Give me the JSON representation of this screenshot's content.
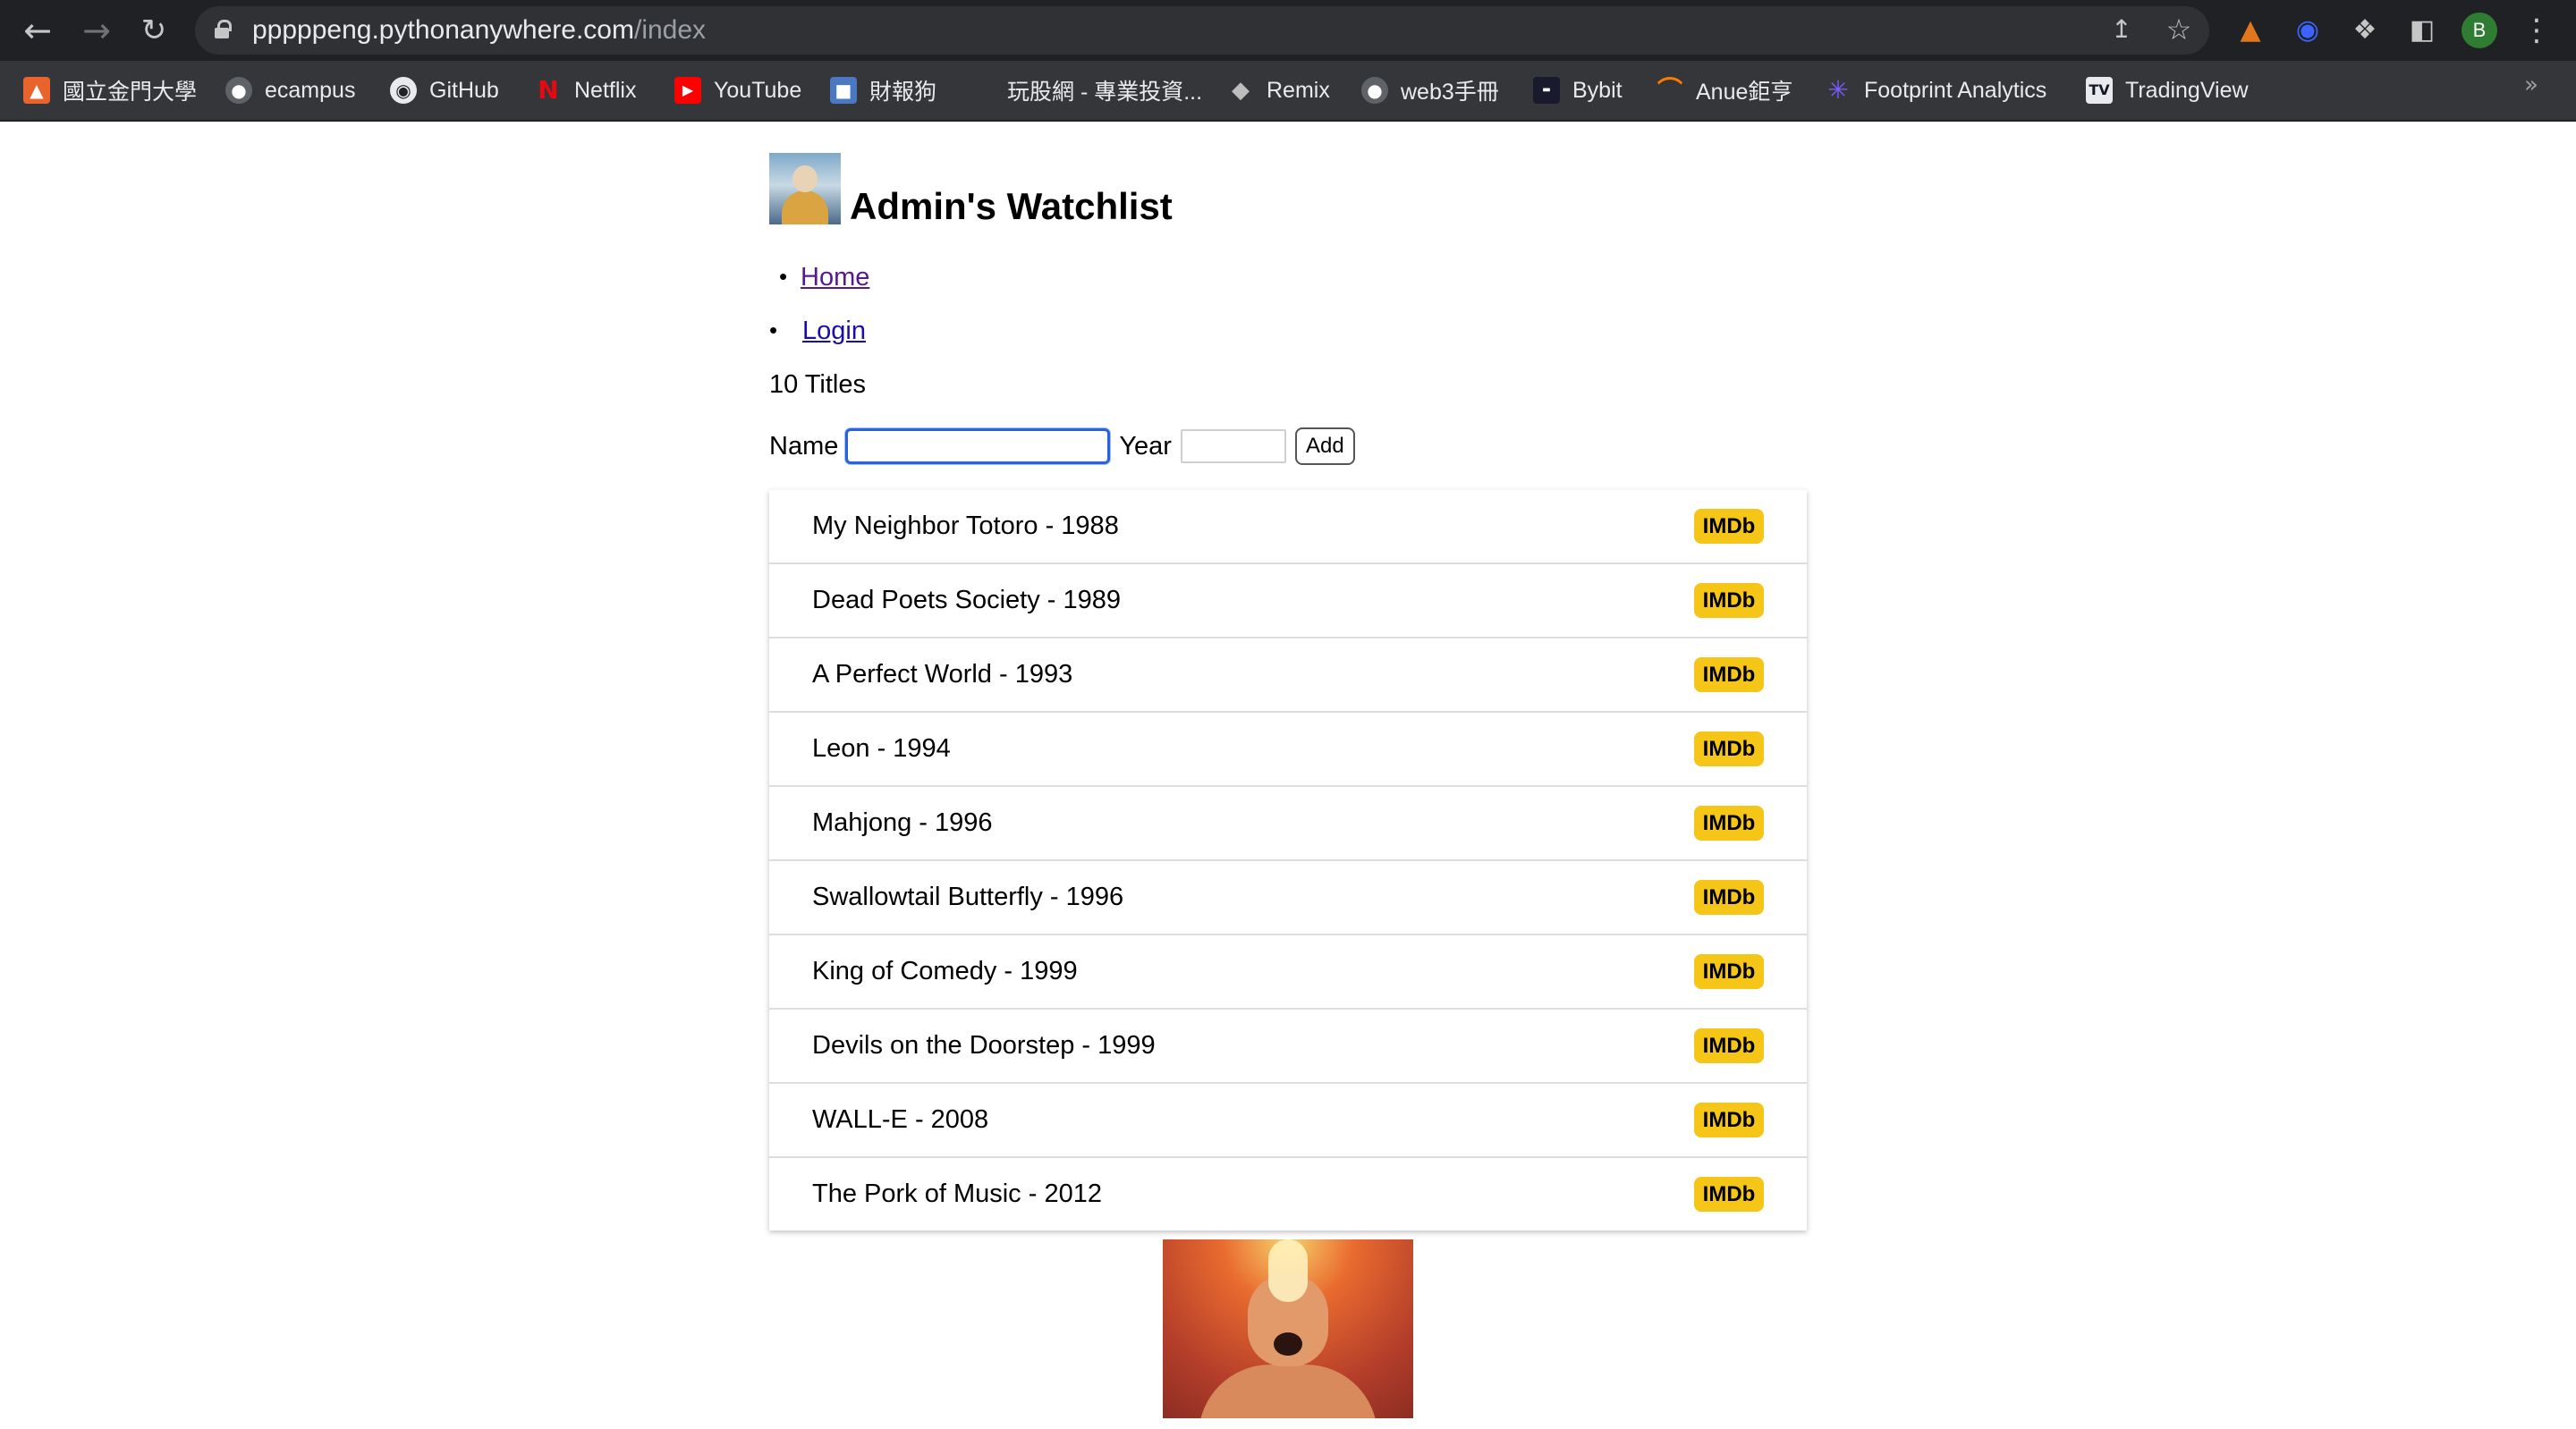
{
  "browser": {
    "url_host": "pppppeng.pythonanywhere.com",
    "url_path": "/index",
    "profile_initial": "B"
  },
  "bookmarks": [
    {
      "label": "國立金門大學",
      "icon": "school-icon",
      "color": "#e8642c"
    },
    {
      "label": "ecampus",
      "icon": "globe-icon",
      "color": "#5f6368"
    },
    {
      "label": "GitHub",
      "icon": "github-icon",
      "color": "#5f6368"
    },
    {
      "label": "Netflix",
      "icon": "netflix-icon",
      "color": "#e50914"
    },
    {
      "label": "YouTube",
      "icon": "youtube-icon",
      "color": "#ff0000"
    },
    {
      "label": "財報狗",
      "icon": "dog-icon",
      "color": "#4a78c2"
    },
    {
      "label": "玩股網 - 專業投資...",
      "icon": "",
      "color": ""
    },
    {
      "label": "Remix",
      "icon": "remix-icon",
      "color": "#202124"
    },
    {
      "label": "web3手冊",
      "icon": "globe-icon",
      "color": "#5f6368"
    },
    {
      "label": "Bybit",
      "icon": "bybit-icon",
      "color": "#1a1a2e"
    },
    {
      "label": "Anue鉅亨",
      "icon": "anue-icon",
      "color": "#ff7a00"
    },
    {
      "label": "Footprint Analytics",
      "icon": "footprint-icon",
      "color": "#7b5cff"
    },
    {
      "label": "TradingView",
      "icon": "tradingview-icon",
      "color": "#131722"
    }
  ],
  "header": {
    "title": "Admin's Watchlist"
  },
  "nav": {
    "home": "Home",
    "login": "Login"
  },
  "count_text": "10 Titles",
  "form": {
    "name_label": "Name",
    "name_value": "",
    "year_label": "Year",
    "year_value": "",
    "add_label": "Add"
  },
  "imdb_label": "IMDb",
  "imdb_color": "#f5c518",
  "movies": [
    {
      "text": "My Neighbor Totoro - 1988"
    },
    {
      "text": "Dead Poets Society - 1989"
    },
    {
      "text": "A Perfect World - 1993"
    },
    {
      "text": "Leon - 1994"
    },
    {
      "text": "Mahjong - 1996"
    },
    {
      "text": "Swallowtail Butterfly - 1996"
    },
    {
      "text": "King of Comedy - 1999"
    },
    {
      "text": "Devils on the Doorstep - 1999"
    },
    {
      "text": "WALL-E - 2008"
    },
    {
      "text": "The Pork of Music - 2012"
    }
  ]
}
